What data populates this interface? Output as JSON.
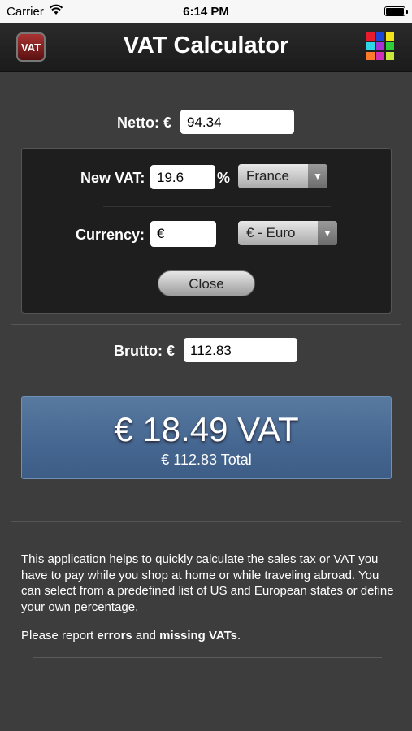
{
  "status_bar": {
    "carrier": "Carrier",
    "time": "6:14 PM"
  },
  "nav": {
    "icon_text": "VAT",
    "title": "VAT Calculator",
    "grid_colors": [
      "#e81c2c",
      "#1a47d8",
      "#f2e21a",
      "#2fd6e5",
      "#a832d6",
      "#2fcf3a",
      "#ff7a2a",
      "#d22fb8",
      "#c9e63a"
    ]
  },
  "netto": {
    "label": "Netto: €",
    "value": "94.34"
  },
  "panel": {
    "vat_label": "New VAT:",
    "vat_value": "19.6",
    "percent": "%",
    "country_select": "France",
    "currency_label": "Currency:",
    "currency_value": "€",
    "currency_select": "€ - Euro",
    "close_label": "Close"
  },
  "brutto": {
    "label": "Brutto: €",
    "value": "112.83"
  },
  "result": {
    "vat_text": "€ 18.49 VAT",
    "total_text": "€ 112.83 Total"
  },
  "description": "This application helps to quickly calculate the sales tax or VAT you have to pay while you shop at home or while traveling abroad. You can select from a predefined list of US and European states or define your own percentage.",
  "report": {
    "prefix": "Please report ",
    "errors": "errors",
    "and": " and ",
    "missing": "missing VATs",
    "suffix": "."
  }
}
